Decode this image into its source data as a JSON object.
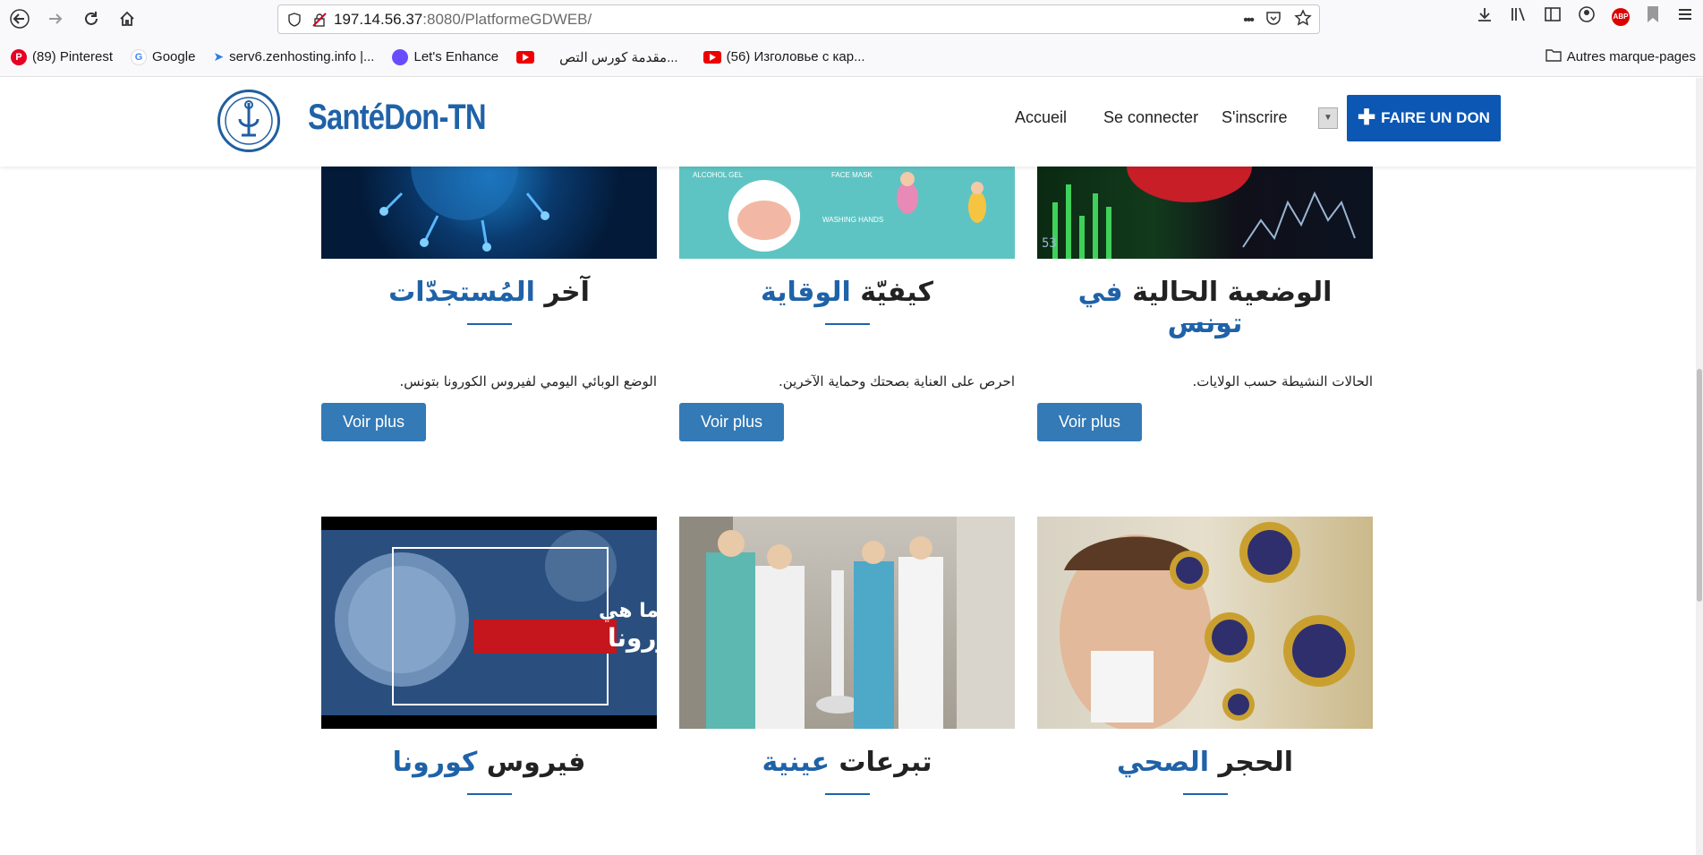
{
  "browser": {
    "url_host": "197.14.56.37",
    "url_port": ":8080",
    "url_path": "/PlatformeGDWEB/",
    "more_label": "•••",
    "bookmarks": [
      {
        "label": "(89) Pinterest",
        "icon": "pinterest-icon"
      },
      {
        "label": "Google",
        "icon": "google-icon"
      },
      {
        "label": "serv6.zenhosting.info |...",
        "icon": "arrow-icon"
      },
      {
        "label": "Let's Enhance",
        "icon": "enhance-icon"
      },
      {
        "label": "",
        "icon": "youtube-icon"
      },
      {
        "label": "مقدمة كورس التص...",
        "icon": ""
      },
      {
        "label": "(56) Изголовье с кар...",
        "icon": "youtube-icon"
      }
    ],
    "other_bookmarks": "Autres marque-pages"
  },
  "header": {
    "site_title": "SantéDon-TN",
    "menu": [
      "Accueil",
      "Se connecter",
      "S'inscrire"
    ],
    "donate_label": "FAIRE UN DON"
  },
  "cards": [
    {
      "title_plain": "آخر ",
      "title_hl": "المُستجدّات",
      "desc": "الوضع الوبائي اليومي لفيروس الكورونا بتونس.",
      "button": "Voir plus"
    },
    {
      "title_plain": "كيفيّة ",
      "title_hl": "الوقاية",
      "desc": "احرص على العناية بصحتك وحماية الآخرين.",
      "button": "Voir plus"
    },
    {
      "title_plain": "الوضعية الحالية ",
      "title_hl": "في تونس",
      "desc": "الحالات النشيطة حسب الولايات.",
      "button": "Voir plus"
    },
    {
      "title_plain": "فيروس ",
      "title_hl": "كورونا",
      "img_text_1": "ما هي",
      "img_text_2": "الكورونا"
    },
    {
      "title_plain": "تبرعات ",
      "title_hl": "عينية"
    },
    {
      "title_plain": "الحجر ",
      "title_hl": "الصحي"
    }
  ],
  "image_labels": {
    "alcohol_gel": "ALCOHOL GEL",
    "face_mask": "FACE MASK",
    "washing_hands": "WASHING HANDS"
  },
  "colors": {
    "brand": "#1f62a8",
    "button": "#337ab7",
    "donate": "#0c57b3"
  }
}
